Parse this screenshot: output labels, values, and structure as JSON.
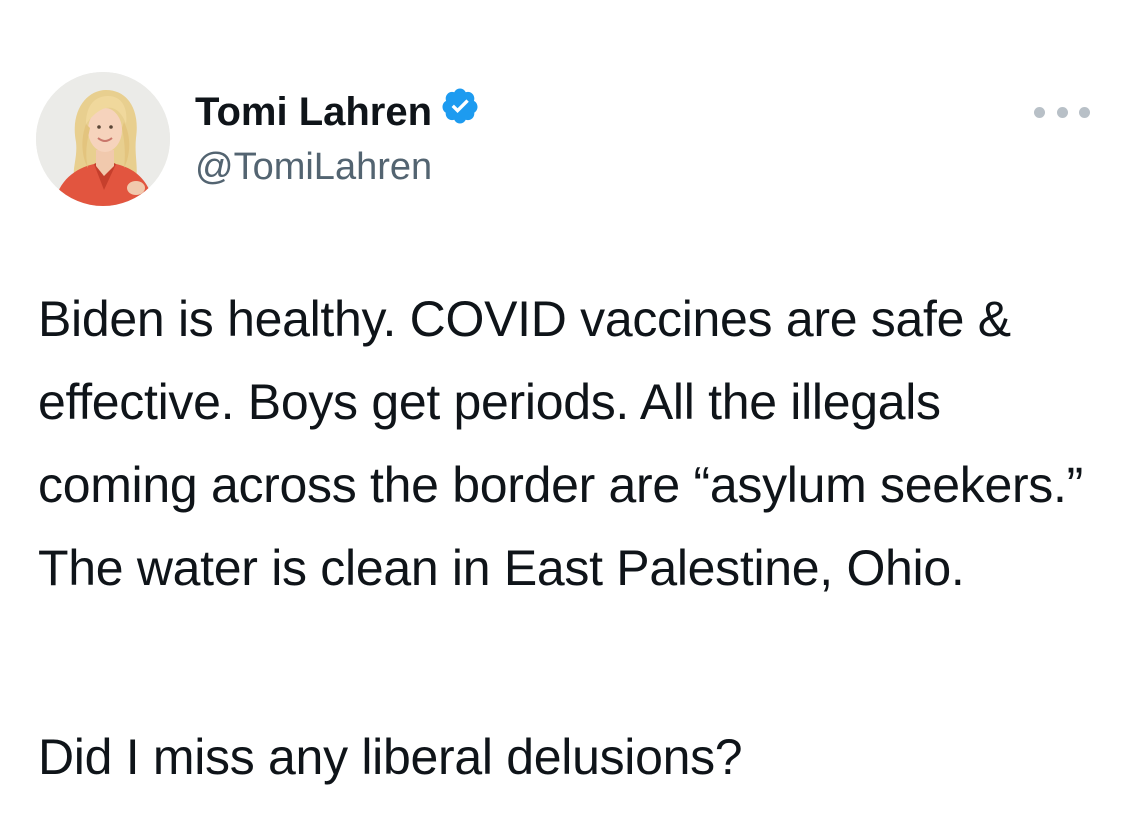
{
  "author": {
    "name": "Tomi Lahren",
    "handle": "@TomiLahren",
    "verified": true,
    "avatar_icon": "profile-photo",
    "verified_color": "#1d9bf0"
  },
  "tweet": {
    "paragraph_1": "Biden is healthy. COVID vaccines are safe & effective. Boys get periods. All the illegals coming across the border are “asylum seekers.” The water is clean in East Palestine, Ohio.",
    "paragraph_2": "Did I miss any liberal delusions?"
  },
  "menu": {
    "icon": "more-options-icon"
  }
}
